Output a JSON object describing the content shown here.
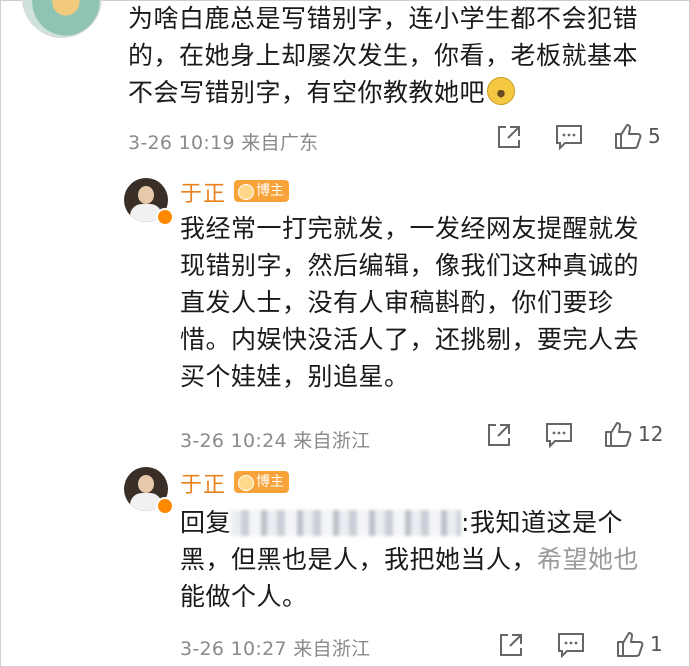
{
  "comment1": {
    "line1": "为啥白鹿总是写错别字，连小学生都不会犯错",
    "line2": "的，在她身上却屡次发生，你看，老板就基本",
    "line3": "不会写错别字，有空你教教她吧",
    "emoji": "crying-laughing-emoji",
    "meta": "3-26 10:19  来自广东",
    "likes": "5"
  },
  "reply1": {
    "name": "于正",
    "tag": "博主",
    "line1": "我经常一打完就发，一发经网友提醒就发",
    "line2": "现错别字，然后编辑，像我们这种真诚的",
    "line3": "直发人士，没有人审稿斟酌，你们要珍",
    "line4": "惜。内娱快没活人了，还挑剔，要完人去",
    "line5": "买个娃娃，别追星。",
    "meta": "3-26 10:24  来自浙江",
    "likes": "12"
  },
  "reply2": {
    "name": "于正",
    "tag": "博主",
    "prefix": "回复",
    "after_blur": ":我知道这是个",
    "line2a": "黑，但黑也是人，我把她当人，",
    "line2b": "希望她也",
    "line3": "能做个人。",
    "meta": "3-26 10:27  来自浙江",
    "likes": "1"
  },
  "colors": {
    "name_orange": "#e8821e",
    "tag_bg": "#f7a339",
    "meta_gray": "#8a8a8a"
  }
}
